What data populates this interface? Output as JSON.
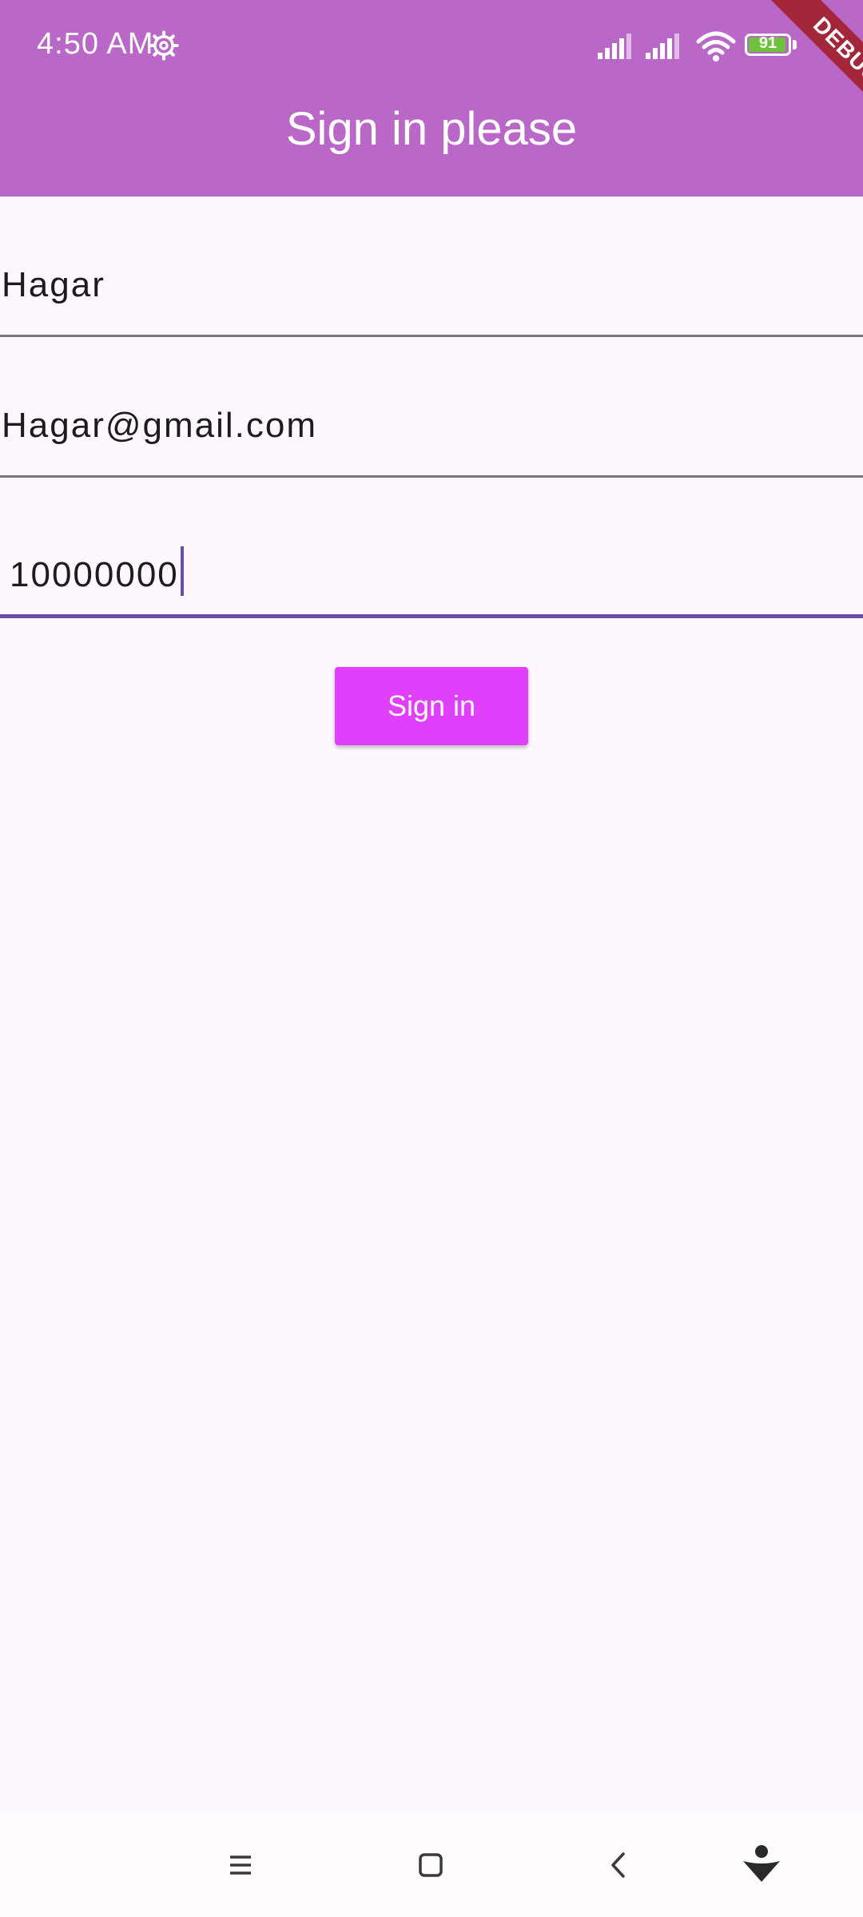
{
  "status_bar": {
    "time": "4:50 AM",
    "battery_level": "91",
    "icons": [
      "gear-icon",
      "signal-icon",
      "signal-icon",
      "wifi-icon",
      "battery-icon"
    ]
  },
  "app_bar": {
    "title": "Sign in please",
    "debug_label": "DEBUG",
    "color": "#b968c7"
  },
  "form": {
    "name_value": "Hagar",
    "email_value": "Hagar@gmail.com",
    "password_value": "10000000",
    "focus_color": "#6750a4"
  },
  "button": {
    "sign_in_label": "Sign in",
    "color": "#e040fb"
  },
  "nav_bar": {
    "icons": [
      "menu-icon",
      "home-icon",
      "back-icon",
      "assistant-icon"
    ]
  }
}
